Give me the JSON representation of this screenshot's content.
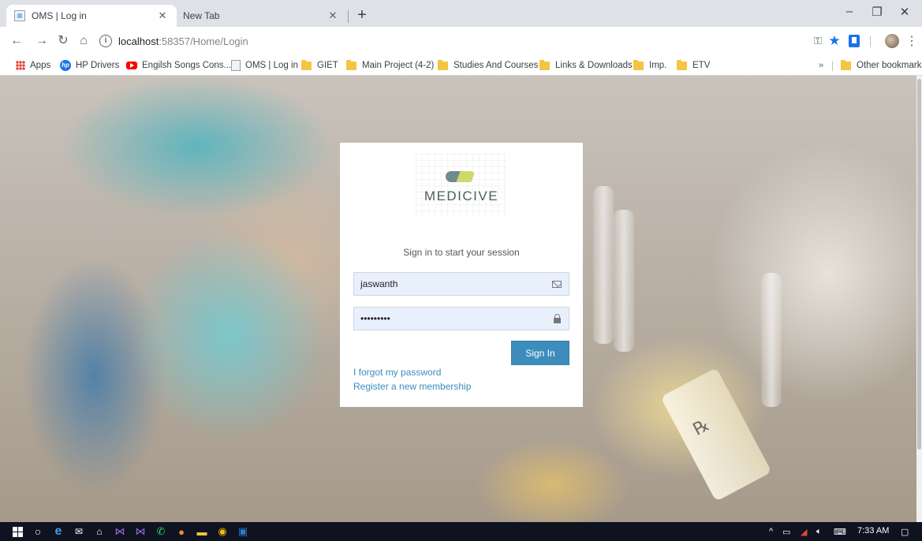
{
  "browser": {
    "tabs": [
      {
        "title": "OMS | Log in",
        "active": true
      },
      {
        "title": "New Tab",
        "active": false
      }
    ],
    "address": {
      "host": "localhost",
      "path": ":58357/Home/Login"
    },
    "bookmarks": [
      {
        "label": "Apps",
        "icon": "apps-grid-icon"
      },
      {
        "label": "HP Drivers",
        "icon": "hp-icon"
      },
      {
        "label": "Engilsh Songs Cons...",
        "icon": "youtube-icon"
      },
      {
        "label": "OMS | Log in",
        "icon": "page-icon"
      },
      {
        "label": "GIET",
        "icon": "folder-icon"
      },
      {
        "label": "Main Project (4-2)",
        "icon": "folder-icon"
      },
      {
        "label": "Studies And Courses",
        "icon": "folder-icon"
      },
      {
        "label": "Links & Downloads",
        "icon": "folder-icon"
      },
      {
        "label": "Imp.",
        "icon": "folder-icon"
      },
      {
        "label": "ETV",
        "icon": "folder-icon"
      }
    ],
    "overflow": "»",
    "other_bookmarks": "Other bookmarks"
  },
  "login": {
    "brand": "MEDICIVE",
    "message": "Sign in to start your session",
    "username_value": "jaswanth",
    "password_value": "jaswanth1",
    "signin_label": "Sign In",
    "forgot_link": "I forgot my password",
    "register_link": "Register a new membership",
    "accent_color": "#3c8dbc"
  },
  "taskbar": {
    "time": "7:33 AM"
  }
}
